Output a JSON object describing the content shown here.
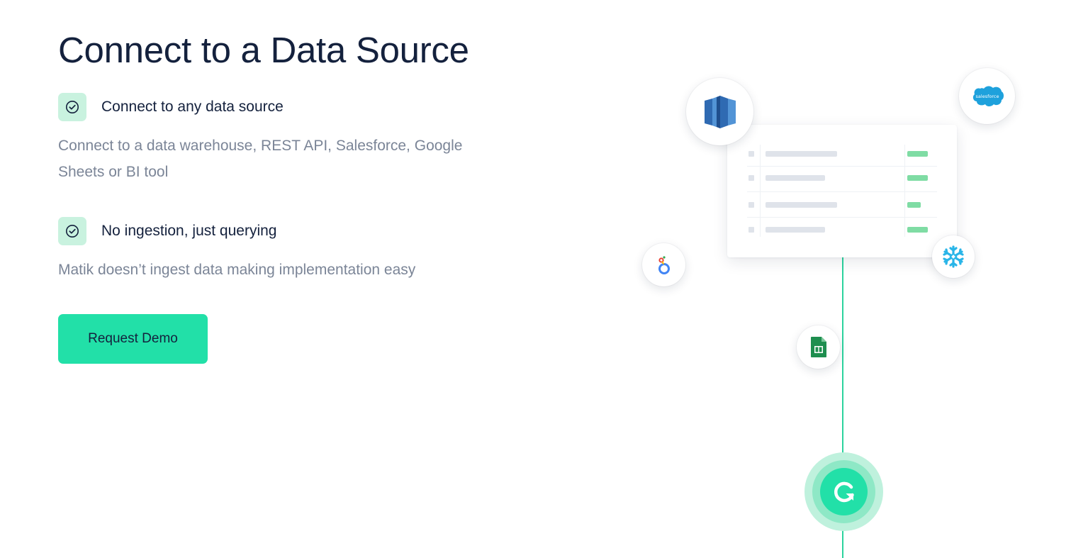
{
  "section": {
    "title": "Connect to a Data Source"
  },
  "features": [
    {
      "icon": "check-circle-icon",
      "title": "Connect to any data source",
      "description": "Connect to a data warehouse, REST API, Salesforce, Google Sheets or BI tool"
    },
    {
      "icon": "check-circle-icon",
      "title": "No ingestion, just querying",
      "description": "Matik doesn’t ingest data making implementation easy"
    }
  ],
  "cta": {
    "label": "Request Demo"
  },
  "illustration": {
    "logos": [
      {
        "name": "amazon-redshift-logo-icon"
      },
      {
        "name": "salesforce-logo-icon",
        "text": "salesforce"
      },
      {
        "name": "looker-logo-icon"
      },
      {
        "name": "snowflake-logo-icon"
      },
      {
        "name": "google-sheets-logo-icon"
      }
    ],
    "table_rows": 4,
    "sync_icon": "sync-refresh-icon"
  },
  "colors": {
    "heading": "#14213d",
    "body_text": "#7b8597",
    "accent": "#22e0a8",
    "check_badge_bg": "#c9f2df",
    "connector": "#2cd39e",
    "salesforce": "#1ea1dc",
    "snowflake": "#29b5e8",
    "sheets": "#1e8e4f",
    "redshift": "#2f6ab2"
  }
}
